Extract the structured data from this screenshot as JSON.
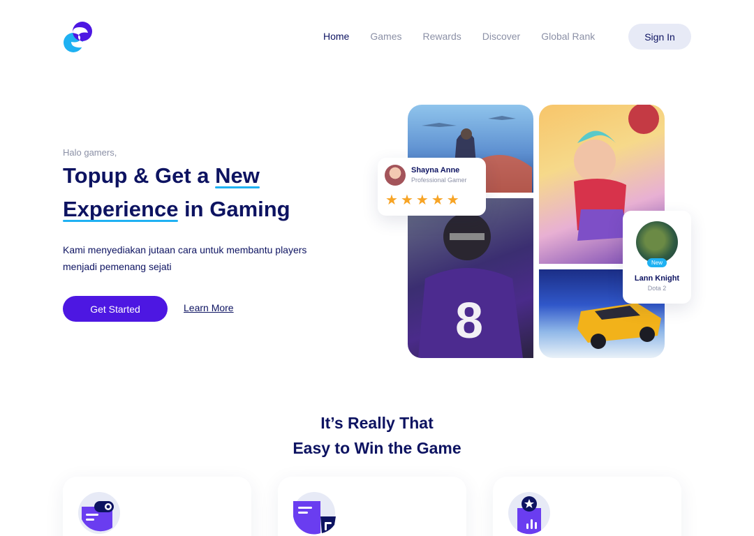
{
  "nav": {
    "logo_icon": "s-brand-logo-icon",
    "links": [
      {
        "label": "Home",
        "active": true
      },
      {
        "label": "Games",
        "active": false
      },
      {
        "label": "Rewards",
        "active": false
      },
      {
        "label": "Discover",
        "active": false
      },
      {
        "label": "Global Rank",
        "active": false
      }
    ],
    "signin_label": "Sign In"
  },
  "hero": {
    "greeting": "Halo gamers,",
    "title_part1": "Topup & Get a ",
    "title_highlight1": "New",
    "title_highlight2": "Experience",
    "title_part2": " in Gaming",
    "description": "Kami menyediakan jutaan cara untuk membantu players menjadi pemenang sejati",
    "primary_button": "Get Started",
    "secondary_link": "Learn More"
  },
  "collage": {
    "profile_card": {
      "name": "Shayna Anne",
      "role": "Professional Gamer",
      "rating": 5,
      "star_icon": "star-icon"
    },
    "player_card": {
      "badge": "New",
      "name": "Lann Knight",
      "game": "Dota 2"
    }
  },
  "features": {
    "title_line1": "It’s Really That",
    "title_line2": "Easy to Win the Game",
    "cards": [
      {
        "icon": "gamepad-toggle-icon"
      },
      {
        "icon": "chat-bubbles-icon"
      },
      {
        "icon": "star-ranking-chart-icon"
      }
    ]
  },
  "colors": {
    "primary": "#4d17e2",
    "navy": "#0d1361",
    "accent_cyan": "#1fb1f2",
    "muted": "#8b90a6",
    "star": "#f7a425"
  }
}
